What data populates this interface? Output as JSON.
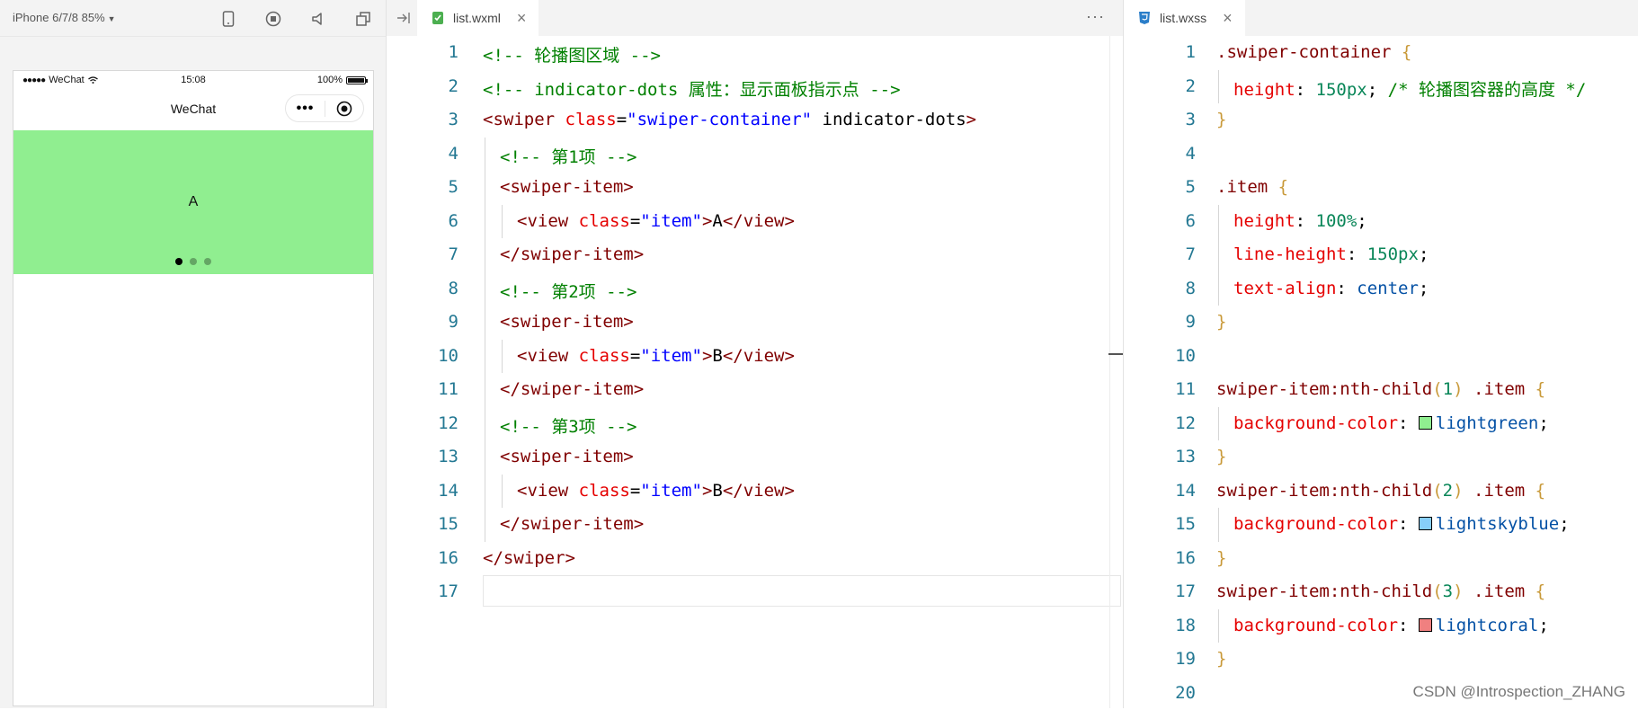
{
  "simulator": {
    "device_label": "iPhone 6/7/8 85%",
    "statusbar": {
      "carrier": "WeChat",
      "time": "15:08",
      "battery": "100%"
    },
    "navbar": {
      "title": "WeChat"
    },
    "swiper": {
      "current_text": "A",
      "current_color": "#90ee90",
      "dot_count": 3,
      "active_dot": 1
    }
  },
  "wxml": {
    "tab_label": "list.wxml",
    "lines": [
      {
        "n": "1",
        "parts": [
          [
            "c-comment",
            "<!-- 轮播图区域 -->"
          ]
        ]
      },
      {
        "n": "2",
        "parts": [
          [
            "c-comment",
            "<!-- indicator-dots 属性：显示面板指示点 -->"
          ]
        ]
      },
      {
        "n": "3",
        "parts": [
          [
            "c-tag",
            "<swiper "
          ],
          [
            "c-attr",
            "class"
          ],
          [
            "c-plain",
            "="
          ],
          [
            "c-str",
            "\"swiper-container\""
          ],
          [
            "c-plain",
            " indicator-dots"
          ],
          [
            "c-tag",
            ">"
          ]
        ]
      },
      {
        "n": "4",
        "indent": 1,
        "parts": [
          [
            "c-comment",
            "<!-- 第1项 -->"
          ]
        ]
      },
      {
        "n": "5",
        "indent": 1,
        "parts": [
          [
            "c-tag",
            "<swiper-item>"
          ]
        ]
      },
      {
        "n": "6",
        "indent": 2,
        "parts": [
          [
            "c-tag",
            "<view "
          ],
          [
            "c-attr",
            "class"
          ],
          [
            "c-plain",
            "="
          ],
          [
            "c-str",
            "\"item\""
          ],
          [
            "c-tag",
            ">"
          ],
          [
            "c-plain",
            "A"
          ],
          [
            "c-tag",
            "</view>"
          ]
        ]
      },
      {
        "n": "7",
        "indent": 1,
        "parts": [
          [
            "c-tag",
            "</swiper-item>"
          ]
        ]
      },
      {
        "n": "8",
        "indent": 1,
        "parts": [
          [
            "c-comment",
            "<!-- 第2项 -->"
          ]
        ]
      },
      {
        "n": "9",
        "indent": 1,
        "parts": [
          [
            "c-tag",
            "<swiper-item>"
          ]
        ]
      },
      {
        "n": "10",
        "indent": 2,
        "parts": [
          [
            "c-tag",
            "<view "
          ],
          [
            "c-attr",
            "class"
          ],
          [
            "c-plain",
            "="
          ],
          [
            "c-str",
            "\"item\""
          ],
          [
            "c-tag",
            ">"
          ],
          [
            "c-plain",
            "B"
          ],
          [
            "c-tag",
            "</view>"
          ]
        ]
      },
      {
        "n": "11",
        "indent": 1,
        "parts": [
          [
            "c-tag",
            "</swiper-item>"
          ]
        ]
      },
      {
        "n": "12",
        "indent": 1,
        "parts": [
          [
            "c-comment",
            "<!-- 第3项 -->"
          ]
        ]
      },
      {
        "n": "13",
        "indent": 1,
        "parts": [
          [
            "c-tag",
            "<swiper-item>"
          ]
        ]
      },
      {
        "n": "14",
        "indent": 2,
        "parts": [
          [
            "c-tag",
            "<view "
          ],
          [
            "c-attr",
            "class"
          ],
          [
            "c-plain",
            "="
          ],
          [
            "c-str",
            "\"item\""
          ],
          [
            "c-tag",
            ">"
          ],
          [
            "c-plain",
            "B"
          ],
          [
            "c-tag",
            "</view>"
          ]
        ]
      },
      {
        "n": "15",
        "indent": 1,
        "parts": [
          [
            "c-tag",
            "</swiper-item>"
          ]
        ]
      },
      {
        "n": "16",
        "parts": [
          [
            "c-tag",
            "</swiper>"
          ]
        ]
      },
      {
        "n": "17",
        "parts": []
      }
    ]
  },
  "wxss": {
    "tab_label": "list.wxss",
    "lines": [
      {
        "n": "1",
        "parts": [
          [
            "c-sel",
            ".swiper-container "
          ],
          [
            "c-brace",
            "{"
          ]
        ]
      },
      {
        "n": "2",
        "indent": 1,
        "parts": [
          [
            "c-prop",
            "height"
          ],
          [
            "c-plain",
            ": "
          ],
          [
            "c-num",
            "150px"
          ],
          [
            "c-plain",
            "; "
          ],
          [
            "c-comment",
            "/* 轮播图容器的高度 */"
          ]
        ]
      },
      {
        "n": "3",
        "parts": [
          [
            "c-brace",
            "}"
          ]
        ]
      },
      {
        "n": "4",
        "parts": []
      },
      {
        "n": "5",
        "parts": [
          [
            "c-sel",
            ".item "
          ],
          [
            "c-brace",
            "{"
          ]
        ]
      },
      {
        "n": "6",
        "indent": 1,
        "parts": [
          [
            "c-prop",
            "height"
          ],
          [
            "c-plain",
            ": "
          ],
          [
            "c-num",
            "100%"
          ],
          [
            "c-plain",
            ";"
          ]
        ]
      },
      {
        "n": "7",
        "indent": 1,
        "parts": [
          [
            "c-prop",
            "line-height"
          ],
          [
            "c-plain",
            ": "
          ],
          [
            "c-num",
            "150px"
          ],
          [
            "c-plain",
            ";"
          ]
        ]
      },
      {
        "n": "8",
        "indent": 1,
        "parts": [
          [
            "c-prop",
            "text-align"
          ],
          [
            "c-plain",
            ": "
          ],
          [
            "c-kw",
            "center"
          ],
          [
            "c-plain",
            ";"
          ]
        ]
      },
      {
        "n": "9",
        "parts": [
          [
            "c-brace",
            "}"
          ]
        ]
      },
      {
        "n": "10",
        "parts": []
      },
      {
        "n": "11",
        "parts": [
          [
            "c-sel",
            "swiper-item:nth-child"
          ],
          [
            "c-brace",
            "("
          ],
          [
            "c-num",
            "1"
          ],
          [
            "c-brace",
            ")"
          ],
          [
            "c-sel",
            " .item "
          ],
          [
            "c-brace",
            "{"
          ]
        ]
      },
      {
        "n": "12",
        "indent": 1,
        "parts": [
          [
            "c-prop",
            "background-color"
          ],
          [
            "c-plain",
            ": "
          ],
          [
            "swatch",
            "#90ee90"
          ],
          [
            "c-kw",
            "lightgreen"
          ],
          [
            "c-plain",
            ";"
          ]
        ]
      },
      {
        "n": "13",
        "parts": [
          [
            "c-brace",
            "}"
          ]
        ]
      },
      {
        "n": "14",
        "parts": [
          [
            "c-sel",
            "swiper-item:nth-child"
          ],
          [
            "c-brace",
            "("
          ],
          [
            "c-num",
            "2"
          ],
          [
            "c-brace",
            ")"
          ],
          [
            "c-sel",
            " .item "
          ],
          [
            "c-brace",
            "{"
          ]
        ]
      },
      {
        "n": "15",
        "indent": 1,
        "parts": [
          [
            "c-prop",
            "background-color"
          ],
          [
            "c-plain",
            ": "
          ],
          [
            "swatch",
            "#87cefa"
          ],
          [
            "c-kw",
            "lightskyblue"
          ],
          [
            "c-plain",
            ";"
          ]
        ]
      },
      {
        "n": "16",
        "parts": [
          [
            "c-brace",
            "}"
          ]
        ]
      },
      {
        "n": "17",
        "parts": [
          [
            "c-sel",
            "swiper-item:nth-child"
          ],
          [
            "c-brace",
            "("
          ],
          [
            "c-num",
            "3"
          ],
          [
            "c-brace",
            ")"
          ],
          [
            "c-sel",
            " .item "
          ],
          [
            "c-brace",
            "{"
          ]
        ]
      },
      {
        "n": "18",
        "indent": 1,
        "parts": [
          [
            "c-prop",
            "background-color"
          ],
          [
            "c-plain",
            ": "
          ],
          [
            "swatch",
            "#f08080"
          ],
          [
            "c-kw",
            "lightcoral"
          ],
          [
            "c-plain",
            ";"
          ]
        ]
      },
      {
        "n": "19",
        "parts": [
          [
            "c-brace",
            "}"
          ]
        ]
      },
      {
        "n": "20",
        "parts": []
      }
    ]
  },
  "watermark": "CSDN @Introspection_ZHANG"
}
